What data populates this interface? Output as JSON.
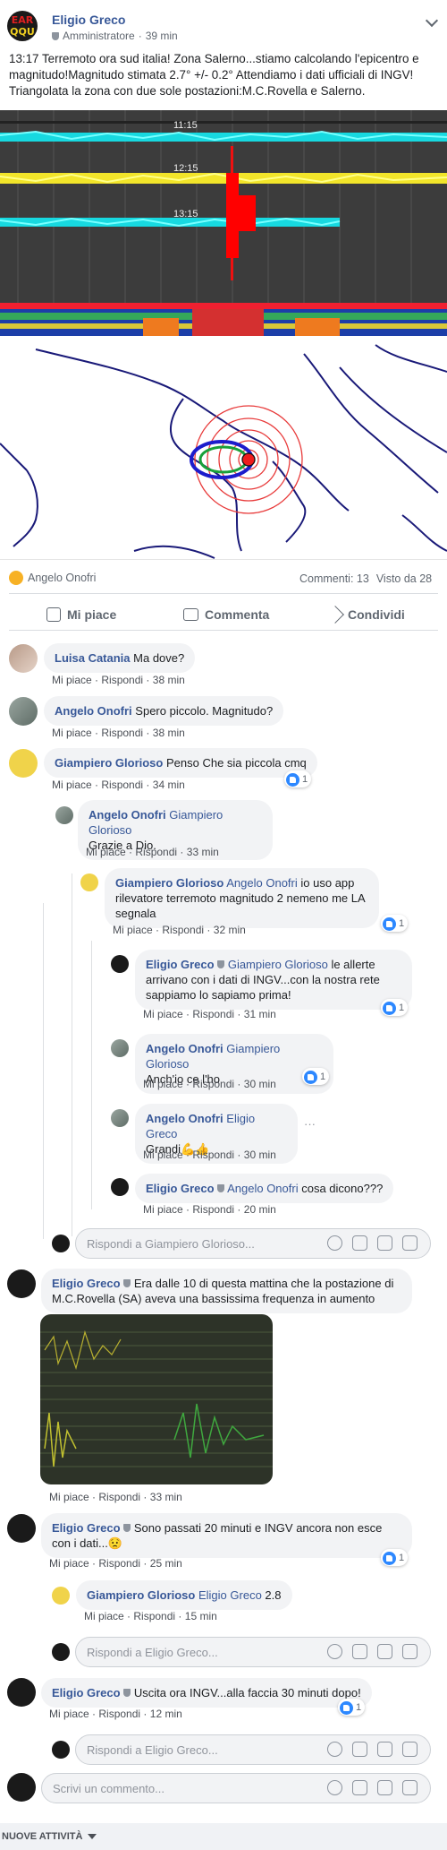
{
  "post": {
    "author": "Eligio Greco",
    "role": "Amministratore",
    "time": "39 min",
    "text": "13:17 Terremoto ora sud italia! Zona Salerno...stiamo calcolando l'epicentro e magnitudo!Magnitudo stimata 2.7° +/- 0.2° Attendiamo i dati ufficiali di INGV! Triangolata la zona con due sole postazioni:M.C.Rovella e Salerno.",
    "avatar_text": [
      "EAR",
      "QQU"
    ],
    "seismo_times": [
      "11:15",
      "12:15",
      "13:15"
    ]
  },
  "stats": {
    "reactor": "Angelo Onofri",
    "comments": "Commenti: 13",
    "views": "Visto da 28"
  },
  "actions": {
    "like": "Mi piace",
    "comment": "Commenta",
    "share": "Condividi"
  },
  "labels": {
    "like": "Mi piace",
    "reply": "Rispondi",
    "sep": "·",
    "more": "···"
  },
  "comments": [
    {
      "author": "Luisa Catania",
      "text": "Ma dove?",
      "time": "38 min"
    },
    {
      "author": "Angelo Onofri",
      "text": "Spero piccolo. Magnitudo?",
      "time": "38 min"
    },
    {
      "author": "Giampiero Glorioso",
      "text": "Penso Che sia piccola cmq",
      "time": "34 min",
      "likes": "1"
    },
    {
      "author": "Angelo Onofri",
      "mention": "Giampiero Glorioso",
      "text": "Grazie a Dio.",
      "time": "33 min"
    },
    {
      "author": "Giampiero Glorioso",
      "mention": "Angelo Onofri",
      "text": "io uso app rilevatore terremoto magnitudo 2 nemeno me LA segnala",
      "time": "32 min",
      "likes": "1"
    },
    {
      "author": "Eligio Greco",
      "mention": "Giampiero Glorioso",
      "text": "le allerte arrivano con i dati di INGV...con la nostra rete sappiamo lo sapiamo prima!",
      "time": "31 min",
      "likes": "1"
    },
    {
      "author": "Angelo Onofri",
      "mention": "Giampiero Glorioso",
      "text": "Anch'io ce l'ho",
      "time": "30 min",
      "likes": "1"
    },
    {
      "author": "Angelo Onofri",
      "mention": "Eligio Greco",
      "text": "Grandi💪👍",
      "time": "30 min"
    },
    {
      "author": "Eligio Greco",
      "mention": "Angelo Onofri",
      "text": "cosa dicono???",
      "time": "20 min"
    },
    {
      "author": "Eligio Greco",
      "text": "Era dalle 10 di questa mattina che la postazione di M.C.Rovella (SA) aveva una bassissima frequenza in aumento",
      "time": "33 min"
    },
    {
      "author": "Eligio Greco",
      "text": "Sono passati 20 minuti e INGV ancora non esce con i dati...😟",
      "time": "25 min",
      "likes": "1"
    },
    {
      "author": "Giampiero Glorioso",
      "mention": "Eligio Greco",
      "text": "2.8",
      "time": "15 min"
    },
    {
      "author": "Eligio Greco",
      "text": "Uscita ora INGV...alla faccia 30 minuti dopo!",
      "time": "12 min",
      "likes": "1"
    }
  ],
  "inputs": {
    "reply_gg": "Rispondi a Giampiero Glorioso...",
    "reply_eg": "Rispondi a Eligio Greco...",
    "reply_eg2": "Rispondi a Eligio Greco...",
    "comment": "Scrivi un commento..."
  },
  "footer": "NUOVE ATTIVITÀ",
  "colors": {
    "link": "#385898",
    "meta": "#606770",
    "bubble": "#f2f3f5",
    "like": "#2d88ff"
  }
}
